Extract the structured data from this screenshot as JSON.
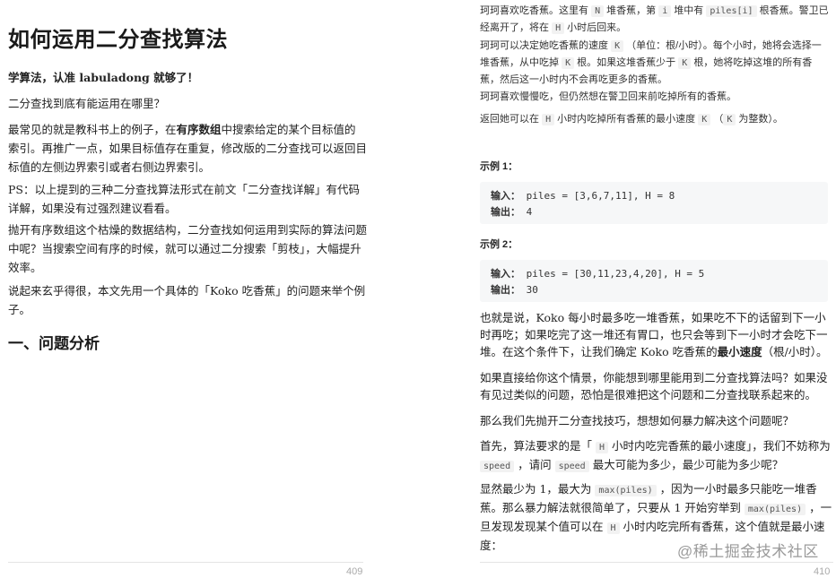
{
  "left_page": {
    "title": "如何运用二分查找算法",
    "intro_bold": "学算法，认准 labuladong 就够了！",
    "q1": "二分查找到底有能运用在哪里？",
    "p1_a": "最常见的就是教科书上的例子，在",
    "p1_bold": "有序数组",
    "p1_b": "中搜索给定的某个目标值的索引。再推广一点，如果目标值存在重复，修改版的二分查找可以返回目标值的左侧边界索引或者右侧边界索引。",
    "ps": "PS：以上提到的三种二分查找算法形式在前文「二分查找详解」有代码详解，如果没有过强烈建议看看。",
    "p2": "抛开有序数组这个枯燥的数据结构，二分查找如何运用到实际的算法问题中呢？当搜索空间有序的时候，就可以通过二分搜索「剪枝」，大幅提升效率。",
    "p3": "说起来玄乎得很，本文先用一个具体的「Koko 吃香蕉」的问题来举个例子。",
    "section": "一、问题分析",
    "page_number": "409"
  },
  "right_page": {
    "prob1_a": "珂珂喜欢吃香蕉。这里有",
    "prob1_N": "N",
    "prob1_b": "堆香蕉，第",
    "prob1_i": "i",
    "prob1_c": "堆中有",
    "prob1_piles": "piles[i]",
    "prob1_d": "根香蕉。警卫已经离开了，将在",
    "prob1_H": "H",
    "prob1_e": "小时后回来。",
    "prob2_a": "珂珂可以决定她吃香蕉的速度",
    "prob2_K": "K",
    "prob2_b": "（单位：根/小时）。每个小时，她将会选择一堆香蕉，从中吃掉",
    "prob2_K2": "K",
    "prob2_c": "根。如果这堆香蕉少于",
    "prob2_K3": "K",
    "prob2_d": "根，她将吃掉这堆的所有香蕉，然后这一小时内不会再吃更多的香蕉。",
    "prob3": "珂珂喜欢慢慢吃，但仍然想在警卫回来前吃掉所有的香蕉。",
    "prob4_a": "返回她可以在",
    "prob4_H": "H",
    "prob4_b": "小时内吃掉所有香蕉的最小速度",
    "prob4_K": "K",
    "prob4_c": "（",
    "prob4_K2": "K",
    "prob4_d": "为整数）。",
    "ex1_label": "示例 1：",
    "ex1_in_label": "输入：",
    "ex1_in": "piles = [3,6,7,11], H = 8",
    "ex1_out_label": "输出：",
    "ex1_out": "4",
    "ex2_label": "示例 2：",
    "ex2_in_label": "输入：",
    "ex2_in": "piles = [30,11,23,4,20], H = 5",
    "ex2_out_label": "输出：",
    "ex2_out": "30",
    "s1_a": "也就是说，Koko 每小时最多吃一堆香蕉，如果吃不下的话留到下一小时再吃；如果吃完了这一堆还有胃口，也只会等到下一小时才会吃下一堆。在这个条件下，让我们确定 Koko 吃香蕉的",
    "s1_bold": "最小速度",
    "s1_b": "（根/小时）。",
    "s2": "如果直接给你这个情景，你能想到哪里能用到二分查找算法吗？如果没有见过类似的问题，恐怕是很难把这个问题和二分查找联系起来的。",
    "s3": "那么我们先抛开二分查找技巧，想想如何暴力解决这个问题呢？",
    "s4_a": "首先，算法要求的是「",
    "s4_H": "H",
    "s4_b": "小时内吃完香蕉的最小速度」，我们不妨称为",
    "s4_speed": "speed",
    "s4_c": "，请问",
    "s4_speed2": "speed",
    "s4_d": "最大可能为多少，最少可能为多少呢？",
    "s5_a": "显然最少为 1，最大为",
    "s5_max": "max(piles)",
    "s5_b": "，因为一小时最多只能吃一堆香蕉。那么暴力解法就很简单了，只要从 1 开始穷举到",
    "s5_max2": "max(piles)",
    "s5_c": "，一旦发现发现某个值可以在",
    "s5_H": "H",
    "s5_d": "小时内吃完所有香蕉，这个值就是最小速度：",
    "page_number": "410",
    "watermark": "@稀土掘金技术社区"
  }
}
